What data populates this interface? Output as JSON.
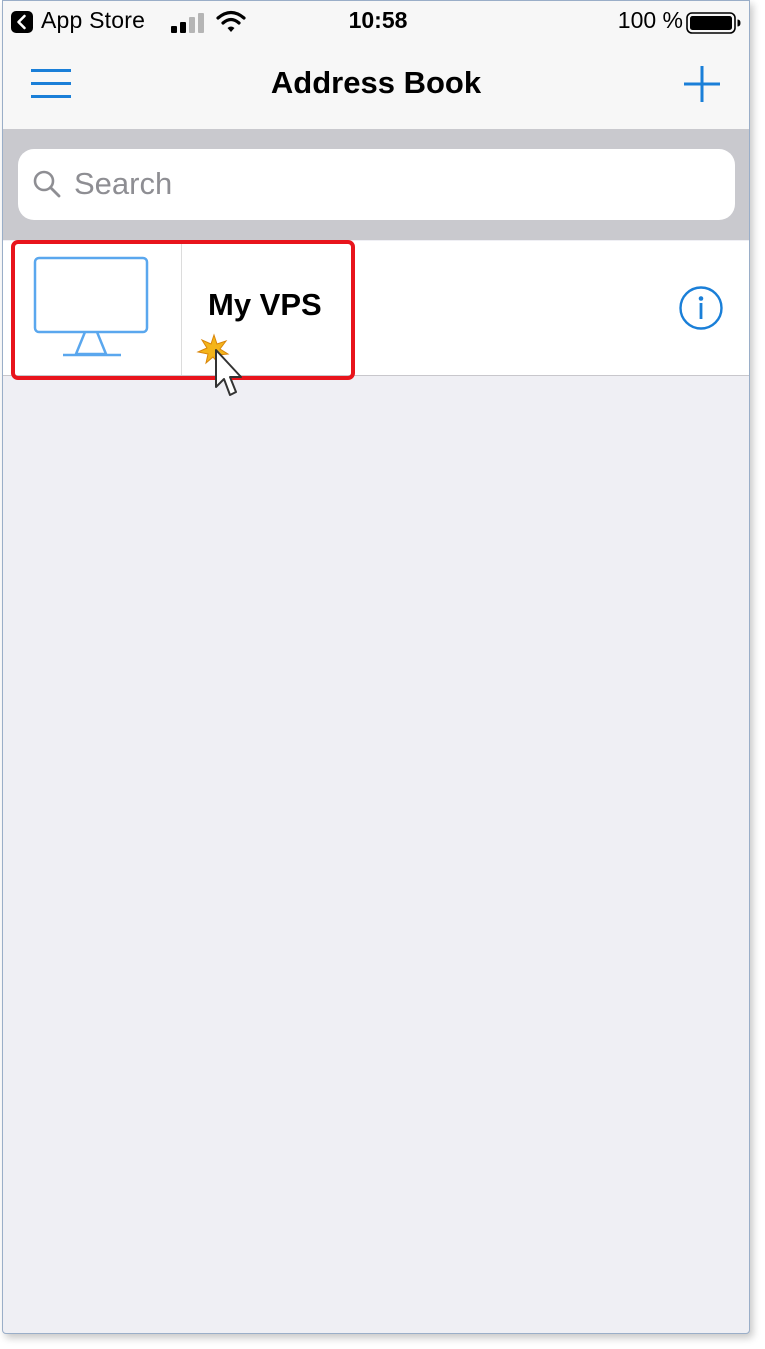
{
  "status_bar": {
    "back_label": "App Store",
    "time": "10:58",
    "battery": "100 %"
  },
  "nav": {
    "title": "Address Book",
    "menu_icon": "hamburger-menu-icon",
    "add_icon": "plus-icon"
  },
  "search": {
    "placeholder": "Search",
    "value": ""
  },
  "connections": [
    {
      "name": "My VPS",
      "icon": "monitor-icon",
      "detail_icon": "info-icon"
    }
  ],
  "colors": {
    "accent": "#1a7fd8",
    "highlight": "#e8141c",
    "background": "#efeff4",
    "bar": "#f7f7f7",
    "search_bar": "#c9c9ce"
  }
}
